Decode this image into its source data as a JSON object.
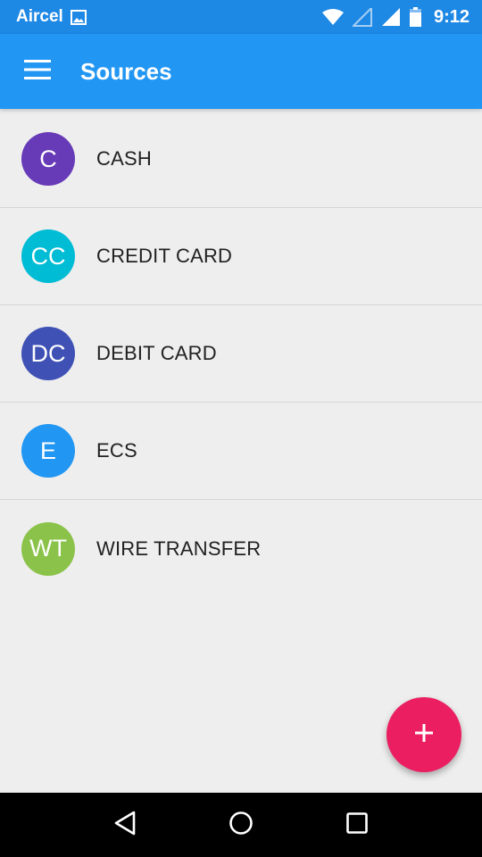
{
  "status_bar": {
    "carrier": "Aircel",
    "time": "9:12",
    "icons": [
      "image-icon",
      "wifi-icon",
      "signal-empty-icon",
      "signal-full-icon",
      "battery-icon"
    ]
  },
  "app_bar": {
    "title": "Sources",
    "menu_icon": "hamburger-menu-icon",
    "color": "#2196F3"
  },
  "sources": [
    {
      "initials": "C",
      "label": "CASH",
      "color": "#673AB7"
    },
    {
      "initials": "CC",
      "label": "CREDIT CARD",
      "color": "#00BCD4"
    },
    {
      "initials": "DC",
      "label": "DEBIT CARD",
      "color": "#3F51B5"
    },
    {
      "initials": "E",
      "label": "ECS",
      "color": "#2196F3"
    },
    {
      "initials": "WT",
      "label": "WIRE TRANSFER",
      "color": "#8BC34A"
    }
  ],
  "fab": {
    "icon": "plus-icon",
    "color": "#EC1E62"
  },
  "nav_bar": {
    "icons": [
      "back-icon",
      "home-icon",
      "recents-icon"
    ]
  }
}
